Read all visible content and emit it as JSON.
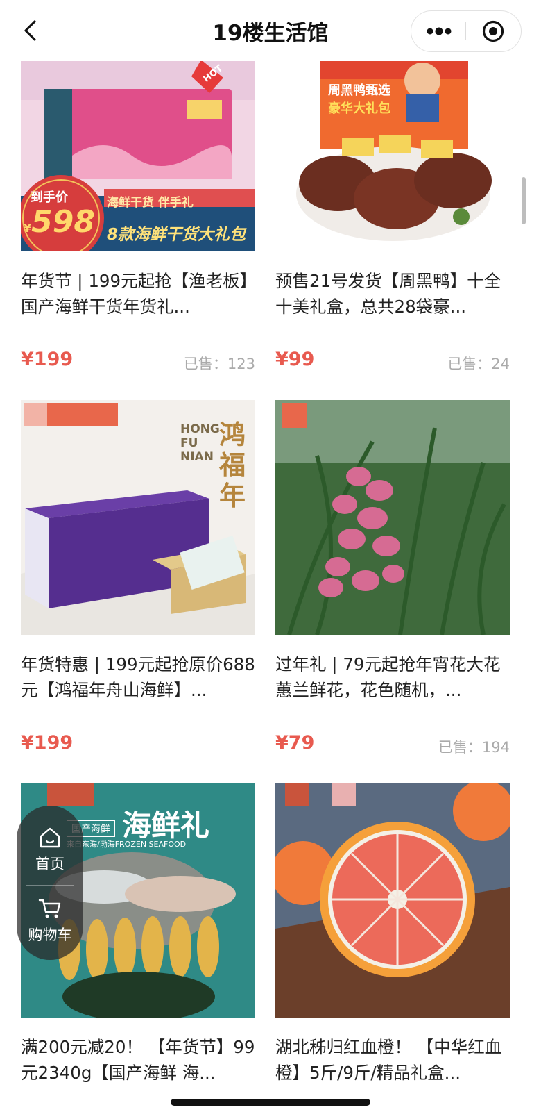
{
  "nav": {
    "title": "19楼生活馆",
    "back_icon": "chevron-left-icon",
    "more_icon": "more-dots-icon",
    "close_icon": "target-close-icon"
  },
  "products": [
    {
      "title": "年货节 | 199元起抢【渔老板】国产海鲜干货年货礼...",
      "price": "¥199",
      "sold": "已售：123",
      "image_text": {
        "badge_label": "到手价",
        "badge_price": "598",
        "banner": "8款海鲜干货大礼包",
        "sub_banner": "海鲜干货 伴手礼",
        "hot": "HOT"
      }
    },
    {
      "title": "预售21号发货【周黑鸭】十全十美礼盒，总共28袋豪...",
      "price": "¥99",
      "sold": "已售：24",
      "image_text": {
        "headline": "周黑鸭甄选",
        "sub": "豪华大礼包"
      }
    },
    {
      "title": "年货特惠 | 199元起抢原价688元【鸿福年舟山海鲜】...",
      "price": "¥199",
      "sold": "",
      "image_text": {
        "brand_en": "HONG FU NIAN",
        "brand_cn": "鸿福年"
      }
    },
    {
      "title": "过年礼 | 79元起抢年宵花大花蕙兰鲜花，花色随机，...",
      "price": "¥79",
      "sold": "已售：194",
      "image_text": {}
    },
    {
      "title": "满200元减20！ 【年货节】99元2340g【国产海鲜 海...",
      "price": "",
      "sold": "",
      "image_text": {
        "headline": "海鲜礼",
        "tag": "国产海鲜",
        "sub": "来自东海/渤海FROZEN SEAFOOD"
      }
    },
    {
      "title": "湖北秭归红血橙！ 【中华红血橙】5斤/9斤/精品礼盒...",
      "price": "",
      "sold": "",
      "image_text": {}
    }
  ],
  "float_nav": {
    "home_label": "首页",
    "cart_label": "购物车"
  },
  "colors": {
    "price": "#e85a4f",
    "accent_orange": "#e8674b"
  }
}
